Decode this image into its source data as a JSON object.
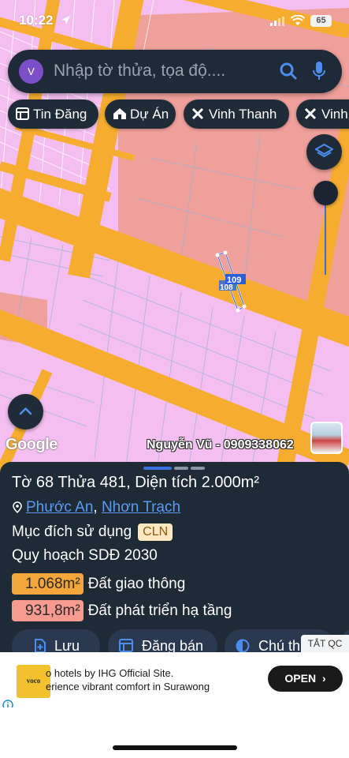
{
  "status_bar": {
    "time": "10:22",
    "battery": "65"
  },
  "search": {
    "avatar_letter": "V",
    "placeholder": "Nhập tờ thửa, tọa độ...."
  },
  "chips": [
    {
      "label": "Tin Đăng",
      "icon": "listing-icon"
    },
    {
      "label": "Dự Án",
      "icon": "house-icon"
    },
    {
      "label": "Vinh Thanh",
      "icon": "tools-icon"
    },
    {
      "label": "Vinh",
      "icon": "tools-icon"
    }
  ],
  "map": {
    "parcel_labels": [
      "109",
      "108"
    ],
    "google_label": "Google",
    "watermark": "Nguyễn Vũ - 0909338062"
  },
  "sheet": {
    "title": "Tờ 68 Thửa 481, Diện tích 2.000m²",
    "address": {
      "ward": "Phước An",
      "separator": ", ",
      "district": "Nhơn Trạch"
    },
    "purpose_label": "Mục đích sử dụng",
    "purpose_code": "CLN",
    "plan_label": "Quy hoạch SDĐ 2030",
    "land_use": [
      {
        "area": "1.068m²",
        "name": "Đất giao thông",
        "color": "#f5a63a"
      },
      {
        "area": "931,8m²",
        "name": "Đất phát triển hạ tầng",
        "color": "#f79a8f"
      }
    ]
  },
  "actions": [
    {
      "label": "Lưu",
      "icon": "save-icon"
    },
    {
      "label": "Đăng bán",
      "icon": "listing-icon"
    },
    {
      "label": "Chú thích",
      "icon": "legend-icon"
    }
  ],
  "ad_close_label": "TẮT QC",
  "ad": {
    "logo_text": "voco",
    "line1": "o hotels by IHG Official Site.",
    "line2": "erience vibrant comfort in Surawong",
    "button": "OPEN"
  },
  "colors": {
    "accent": "#3b6fe0",
    "road": "#f6ad2f",
    "residential": "#f4bff0",
    "commercial": "#f3a0a0",
    "sheet": "#1e2a36"
  }
}
